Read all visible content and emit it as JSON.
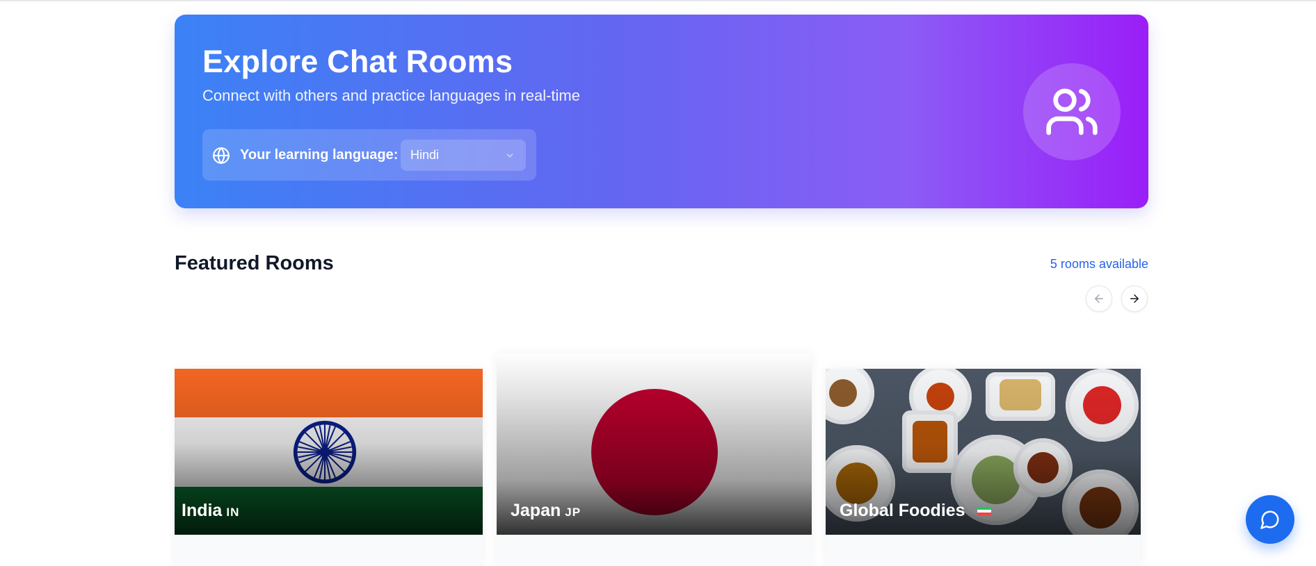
{
  "hero": {
    "title": "Explore Chat Rooms",
    "subtitle": "Connect with others and practice languages in real-time",
    "language_label": "Your learning language:",
    "language_selected": "Hindi",
    "icon": "users-icon",
    "gradient": [
      "#3b82f6",
      "#9b1ef8"
    ]
  },
  "featured": {
    "title": "Featured Rooms",
    "count_text": "5 rooms available",
    "prev_icon": "arrow-left-icon",
    "next_icon": "arrow-right-icon"
  },
  "rooms": [
    {
      "name": "India",
      "code": "IN",
      "image": "india-flag"
    },
    {
      "name": "Japan",
      "code": "JP",
      "image": "japan-flag"
    },
    {
      "name": "Global Foodies",
      "code": "",
      "image": "food-photo"
    }
  ],
  "chat_button": {
    "icon": "message-circle-icon",
    "color": "#1d6cf0"
  }
}
